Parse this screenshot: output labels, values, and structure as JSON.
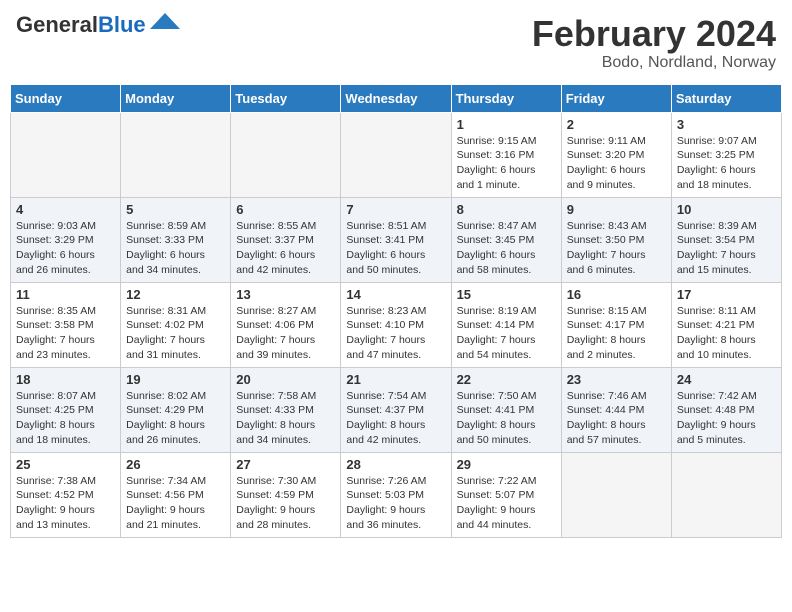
{
  "header": {
    "logo_general": "General",
    "logo_blue": "Blue",
    "month_year": "February 2024",
    "location": "Bodo, Nordland, Norway"
  },
  "days_of_week": [
    "Sunday",
    "Monday",
    "Tuesday",
    "Wednesday",
    "Thursday",
    "Friday",
    "Saturday"
  ],
  "weeks": [
    [
      {
        "day": "",
        "info": ""
      },
      {
        "day": "",
        "info": ""
      },
      {
        "day": "",
        "info": ""
      },
      {
        "day": "",
        "info": ""
      },
      {
        "day": "1",
        "info": "Sunrise: 9:15 AM\nSunset: 3:16 PM\nDaylight: 6 hours\nand 1 minute."
      },
      {
        "day": "2",
        "info": "Sunrise: 9:11 AM\nSunset: 3:20 PM\nDaylight: 6 hours\nand 9 minutes."
      },
      {
        "day": "3",
        "info": "Sunrise: 9:07 AM\nSunset: 3:25 PM\nDaylight: 6 hours\nand 18 minutes."
      }
    ],
    [
      {
        "day": "4",
        "info": "Sunrise: 9:03 AM\nSunset: 3:29 PM\nDaylight: 6 hours\nand 26 minutes."
      },
      {
        "day": "5",
        "info": "Sunrise: 8:59 AM\nSunset: 3:33 PM\nDaylight: 6 hours\nand 34 minutes."
      },
      {
        "day": "6",
        "info": "Sunrise: 8:55 AM\nSunset: 3:37 PM\nDaylight: 6 hours\nand 42 minutes."
      },
      {
        "day": "7",
        "info": "Sunrise: 8:51 AM\nSunset: 3:41 PM\nDaylight: 6 hours\nand 50 minutes."
      },
      {
        "day": "8",
        "info": "Sunrise: 8:47 AM\nSunset: 3:45 PM\nDaylight: 6 hours\nand 58 minutes."
      },
      {
        "day": "9",
        "info": "Sunrise: 8:43 AM\nSunset: 3:50 PM\nDaylight: 7 hours\nand 6 minutes."
      },
      {
        "day": "10",
        "info": "Sunrise: 8:39 AM\nSunset: 3:54 PM\nDaylight: 7 hours\nand 15 minutes."
      }
    ],
    [
      {
        "day": "11",
        "info": "Sunrise: 8:35 AM\nSunset: 3:58 PM\nDaylight: 7 hours\nand 23 minutes."
      },
      {
        "day": "12",
        "info": "Sunrise: 8:31 AM\nSunset: 4:02 PM\nDaylight: 7 hours\nand 31 minutes."
      },
      {
        "day": "13",
        "info": "Sunrise: 8:27 AM\nSunset: 4:06 PM\nDaylight: 7 hours\nand 39 minutes."
      },
      {
        "day": "14",
        "info": "Sunrise: 8:23 AM\nSunset: 4:10 PM\nDaylight: 7 hours\nand 47 minutes."
      },
      {
        "day": "15",
        "info": "Sunrise: 8:19 AM\nSunset: 4:14 PM\nDaylight: 7 hours\nand 54 minutes."
      },
      {
        "day": "16",
        "info": "Sunrise: 8:15 AM\nSunset: 4:17 PM\nDaylight: 8 hours\nand 2 minutes."
      },
      {
        "day": "17",
        "info": "Sunrise: 8:11 AM\nSunset: 4:21 PM\nDaylight: 8 hours\nand 10 minutes."
      }
    ],
    [
      {
        "day": "18",
        "info": "Sunrise: 8:07 AM\nSunset: 4:25 PM\nDaylight: 8 hours\nand 18 minutes."
      },
      {
        "day": "19",
        "info": "Sunrise: 8:02 AM\nSunset: 4:29 PM\nDaylight: 8 hours\nand 26 minutes."
      },
      {
        "day": "20",
        "info": "Sunrise: 7:58 AM\nSunset: 4:33 PM\nDaylight: 8 hours\nand 34 minutes."
      },
      {
        "day": "21",
        "info": "Sunrise: 7:54 AM\nSunset: 4:37 PM\nDaylight: 8 hours\nand 42 minutes."
      },
      {
        "day": "22",
        "info": "Sunrise: 7:50 AM\nSunset: 4:41 PM\nDaylight: 8 hours\nand 50 minutes."
      },
      {
        "day": "23",
        "info": "Sunrise: 7:46 AM\nSunset: 4:44 PM\nDaylight: 8 hours\nand 57 minutes."
      },
      {
        "day": "24",
        "info": "Sunrise: 7:42 AM\nSunset: 4:48 PM\nDaylight: 9 hours\nand 5 minutes."
      }
    ],
    [
      {
        "day": "25",
        "info": "Sunrise: 7:38 AM\nSunset: 4:52 PM\nDaylight: 9 hours\nand 13 minutes."
      },
      {
        "day": "26",
        "info": "Sunrise: 7:34 AM\nSunset: 4:56 PM\nDaylight: 9 hours\nand 21 minutes."
      },
      {
        "day": "27",
        "info": "Sunrise: 7:30 AM\nSunset: 4:59 PM\nDaylight: 9 hours\nand 28 minutes."
      },
      {
        "day": "28",
        "info": "Sunrise: 7:26 AM\nSunset: 5:03 PM\nDaylight: 9 hours\nand 36 minutes."
      },
      {
        "day": "29",
        "info": "Sunrise: 7:22 AM\nSunset: 5:07 PM\nDaylight: 9 hours\nand 44 minutes."
      },
      {
        "day": "",
        "info": ""
      },
      {
        "day": "",
        "info": ""
      }
    ]
  ]
}
